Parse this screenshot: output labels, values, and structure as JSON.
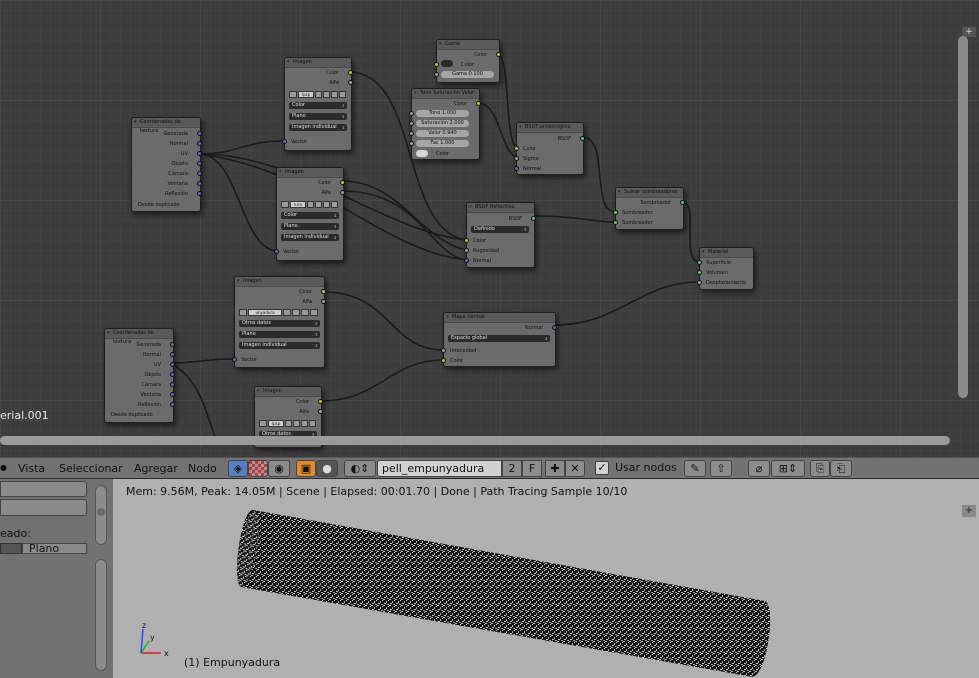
{
  "editor": {
    "material_label": "erial.001",
    "nodes": {
      "tex1": {
        "title": "Coordenadas de textura",
        "outputs": [
          "Generada",
          "Normal",
          "UV",
          "Objeto",
          "Cámara",
          "Ventana",
          "Reflexión"
        ],
        "option": "Desde duplicado"
      },
      "tex2": {
        "title": "Coordenadas de textura",
        "outputs": [
          "Generada",
          "Normal",
          "UV",
          "Objeto",
          "Cámara",
          "Ventana",
          "Reflexión"
        ],
        "option": "Desde duplicado"
      },
      "img1": {
        "title": "Imagen",
        "out_color": "Color",
        "out_alfa": "Alfa",
        "image": "lpsp",
        "color": "Color",
        "proj": "Plano",
        "mode": "Imagen individual",
        "input": "Vector"
      },
      "img2": {
        "title": "Imagen",
        "out_color": "Color",
        "out_alfa": "Alfa",
        "image": "lura",
        "color": "Color",
        "proj": "Plano",
        "mode": "Imagen individual",
        "input": "Vector"
      },
      "img3": {
        "title": "Imagen",
        "out_color": "Color",
        "out_alfa": "Alfa",
        "image": "unyadura",
        "color": "Otros datos",
        "proj": "Plano",
        "mode": "Imagen individual",
        "input": "Vector"
      },
      "img4": {
        "title": "Imagen",
        "out_color": "Color",
        "out_alfa": "Alfa",
        "image": "lpsp",
        "color": "Otros datos"
      },
      "gamma": {
        "title": "Gama",
        "out": "Color",
        "in_color": "Color",
        "gamma": "Gama 0.100"
      },
      "hsv": {
        "title": "Tono Saturación Valor",
        "out": "Color",
        "tono": "Tono 1.000",
        "sat": "Saturación 2.000",
        "val": "Valor 0.940",
        "fac": "Fac 1.000",
        "in_color": "Color"
      },
      "aniso": {
        "title": "BSDF anisotrópico",
        "out": "BSDF",
        "in": [
          "Color",
          "Sigma",
          "Normal"
        ]
      },
      "refl": {
        "title": "BSDF Reflectivo",
        "out": "BSDF",
        "dist": "Definido",
        "in": [
          "Color",
          "Rugosidad",
          "Normal"
        ]
      },
      "add": {
        "title": "Sumar sombreadores",
        "out": "Sombreador",
        "in": [
          "Sombreador",
          "Sombreador"
        ]
      },
      "mat": {
        "title": "Material",
        "in": [
          "Superficie",
          "Volumen",
          "Desplazamiento"
        ]
      },
      "nmap": {
        "title": "Mapa normal",
        "out": "Normal",
        "space": "Espacio global",
        "in": [
          "Intensidad",
          "Color"
        ]
      }
    }
  },
  "header": {
    "menus": [
      "Vista",
      "Seleccionar",
      "Agregar",
      "Nodo"
    ],
    "material_name": "pell_empunyadura",
    "users": "2",
    "fake": "F",
    "use_nodes_label": "Usar nodos",
    "use_nodes_checked": "✓"
  },
  "left_panel": {
    "label": "eado:",
    "value": "Plano"
  },
  "viewport": {
    "status": "Mem: 9.56M, Peak: 14.05M | Scene | Elapsed: 00:01.70 | Done | Path Tracing Sample 10/10",
    "object": "(1) Empunyadura",
    "axis_x": "x",
    "axis_y": "y",
    "axis_z": "z"
  },
  "colors": {
    "socket_color": "#c7c729",
    "socket_vector": "#6363c7",
    "socket_shader": "#63c763",
    "socket_value": "#a1a1a1"
  }
}
